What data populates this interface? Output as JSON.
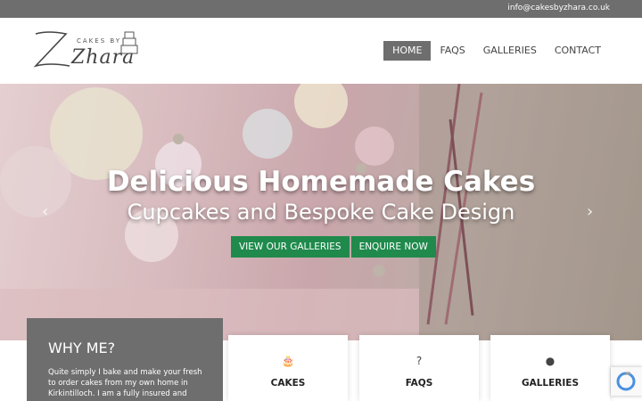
{
  "topbar": {
    "email": "info@cakesbyzhara.co.uk"
  },
  "logo": {
    "small": "CAKES BY",
    "name": "Zhara"
  },
  "nav": [
    {
      "label": "HOME",
      "active": true
    },
    {
      "label": "FAQS"
    },
    {
      "label": "GALLERIES"
    },
    {
      "label": "CONTACT"
    }
  ],
  "hero": {
    "title": "Delicious Homemade Cakes",
    "subtitle": "Cupcakes and Bespoke Cake Design",
    "buttons": [
      "VIEW OUR GALLERIES",
      "ENQUIRE NOW"
    ],
    "prev_icon": "chevron-left-icon",
    "next_icon": "chevron-right-icon"
  },
  "why": {
    "title": "WHY ME?",
    "text": "Quite simply I bake and make your fresh to order cakes from my own home in Kirkintilloch. I am a fully insured and"
  },
  "cards": [
    {
      "icon": "birthday-cake-icon",
      "glyph": "🎂",
      "label": "CAKES"
    },
    {
      "icon": "question-icon",
      "glyph": "?",
      "label": "FAQS"
    },
    {
      "icon": "cookie-icon",
      "glyph": "●",
      "label": "GALLERIES"
    }
  ],
  "colors": {
    "accent": "#1f8a4c",
    "topbar": "#6e6e6e",
    "nav_active": "#6e6e6e"
  }
}
